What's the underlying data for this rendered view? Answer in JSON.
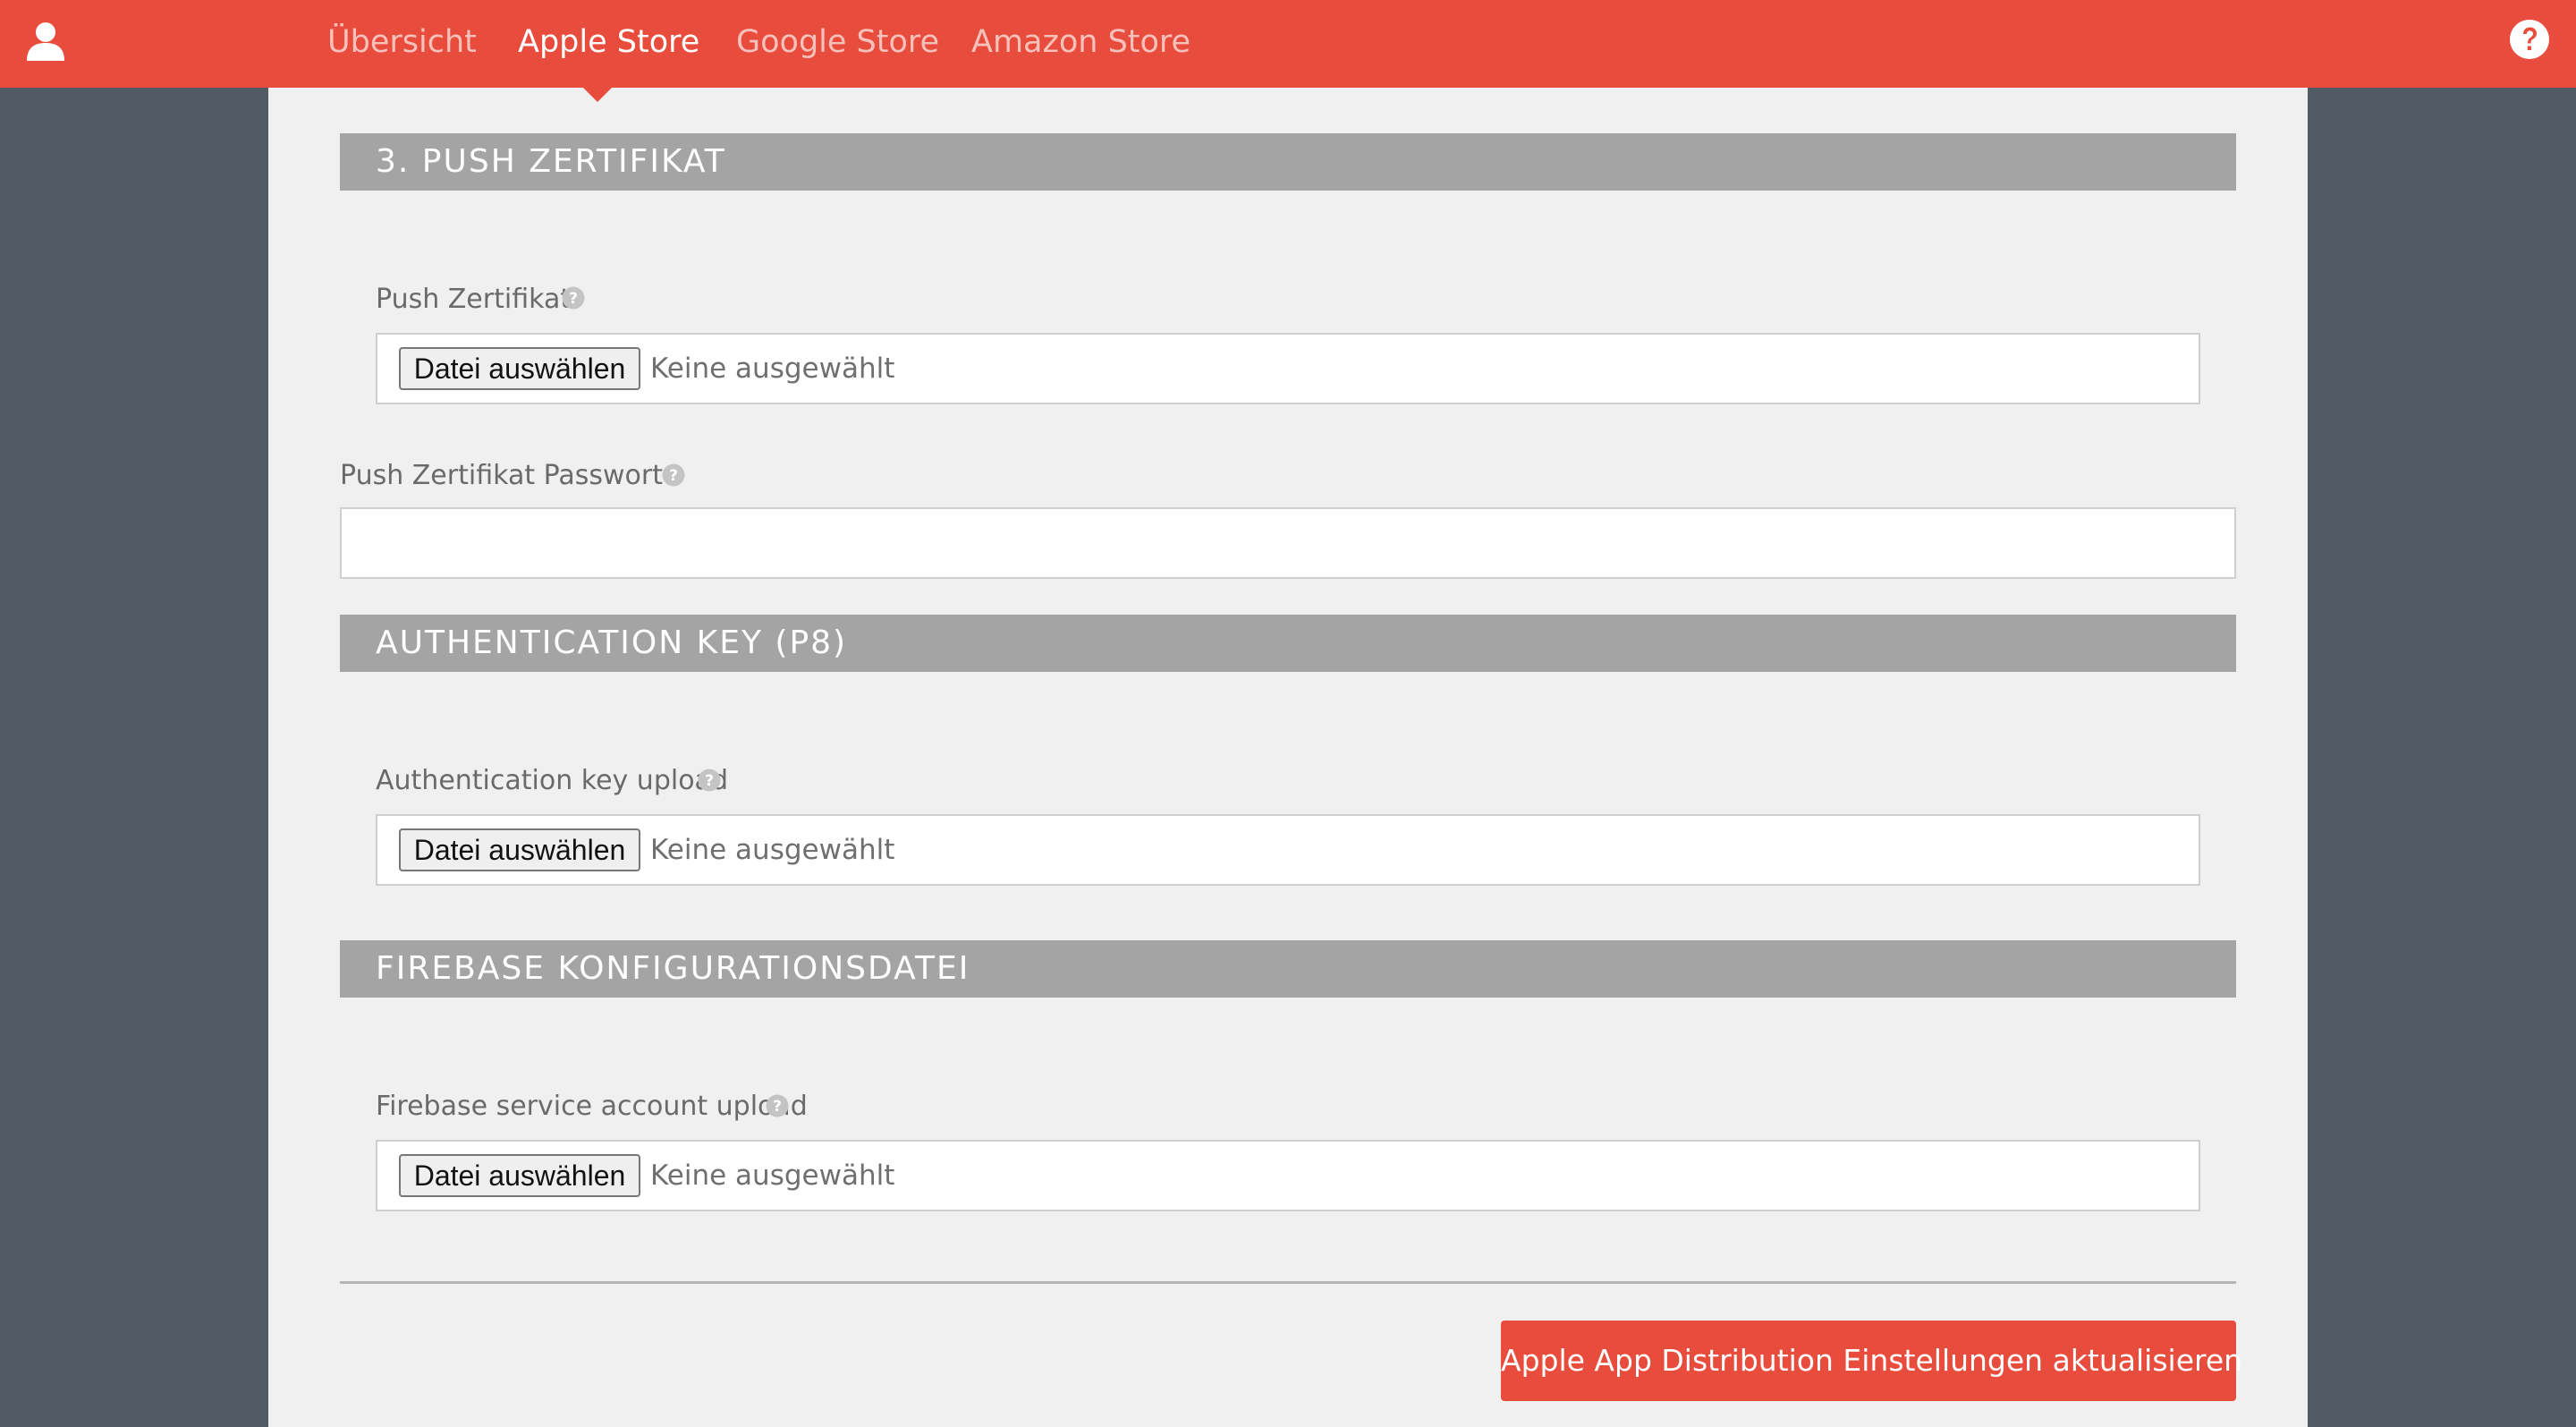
{
  "header": {
    "nav": [
      {
        "label": "Übersicht",
        "active": false
      },
      {
        "label": "Apple Store",
        "active": true
      },
      {
        "label": "Google Store",
        "active": false
      },
      {
        "label": "Amazon Store",
        "active": false
      }
    ],
    "icons": {
      "user": "user-icon",
      "help": "help-icon"
    },
    "colors": {
      "bar": "#e84c3d",
      "active_text": "#ffffff",
      "inactive_text": "#f6c1bb"
    }
  },
  "sections": {
    "push": {
      "title": "3. PUSH ZERTIFIKAT",
      "cert_label": "Push Zertifikat",
      "cert_button": "Datei auswählen",
      "cert_status": "Keine ausgewählt",
      "password_label": "Push Zertifikat Passwort",
      "password_value": ""
    },
    "auth_key": {
      "title": "AUTHENTICATION KEY (P8)",
      "upload_label": "Authentication key upload",
      "upload_button": "Datei auswählen",
      "upload_status": "Keine ausgewählt"
    },
    "firebase": {
      "title": "FIREBASE KONFIGURATIONSDATEI",
      "upload_label": "Firebase service account upload",
      "upload_button": "Datei auswählen",
      "upload_status": "Keine ausgewählt"
    }
  },
  "footer": {
    "submit_label": "Apple App Distribution Einstellungen aktualisieren",
    "accent": "#e84c3d"
  }
}
